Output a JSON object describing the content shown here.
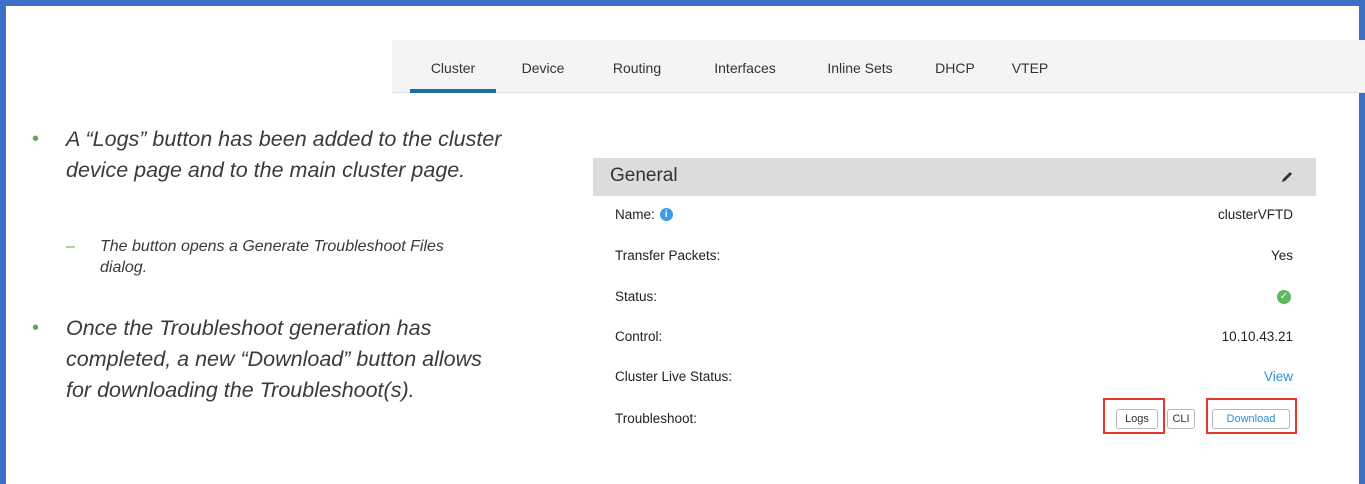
{
  "tabs": [
    {
      "label": "Cluster",
      "active": true
    },
    {
      "label": "Device",
      "active": false
    },
    {
      "label": "Routing",
      "active": false
    },
    {
      "label": "Interfaces",
      "active": false
    },
    {
      "label": "Inline Sets",
      "active": false
    },
    {
      "label": "DHCP",
      "active": false
    },
    {
      "label": "VTEP",
      "active": false
    }
  ],
  "notes": {
    "bullet1": "A “Logs” button has been added to the cluster device page and to the main cluster page.",
    "sub1": "The button opens a Generate Troubleshoot Files dialog.",
    "bullet2": "Once the Troubleshoot generation has completed, a new “Download” button allows for downloading the Troubleshoot(s)."
  },
  "general": {
    "title": "General",
    "name_label": "Name:",
    "name_value": "clusterVFTD",
    "transfer_label": "Transfer Packets:",
    "transfer_value": "Yes",
    "status_label": "Status:",
    "control_label": "Control:",
    "control_value": "10.10.43.21",
    "live_label": "Cluster Live Status:",
    "live_value": "View",
    "troubleshoot_label": "Troubleshoot:",
    "logs_button": "Logs",
    "cli_button": "CLI",
    "download_button": "Download"
  },
  "colors": {
    "frame": "#3f6ec7",
    "accent": "#1d6fa5",
    "bullet": "#6aa84f",
    "link": "#2b8fd6",
    "highlight": "#e2392b",
    "status_ok": "#5bb85c"
  }
}
